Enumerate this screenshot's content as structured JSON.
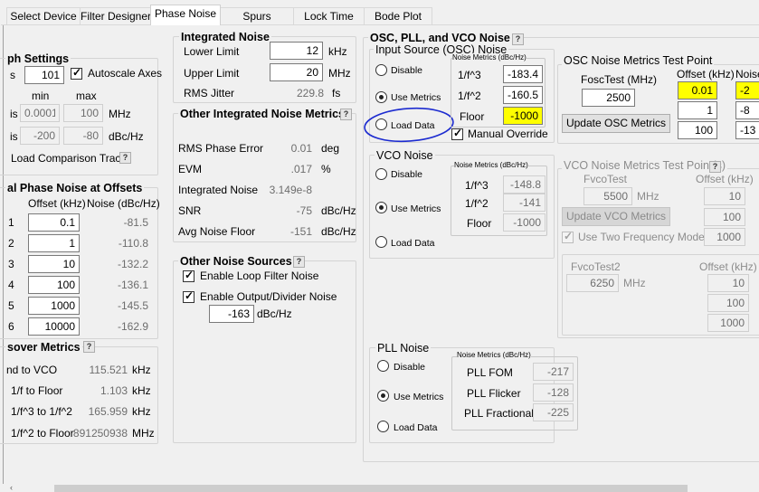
{
  "tabs": [
    "Select Device",
    "Filter Designer",
    "Phase Noise",
    "Spurs",
    "Lock Time",
    "Bode Plot"
  ],
  "graph": {
    "title": "ph Settings",
    "s_label": "s",
    "s_value": "101",
    "autoscale": "Autoscale Axes",
    "min": "min",
    "max": "max",
    "is1": "is",
    "xmin": "0.0001",
    "xmax": "100",
    "xunit": "MHz",
    "is2": "is",
    "ymin": "-200",
    "ymax": "-80",
    "yunit": "dBc/Hz",
    "load_trace": "Load Comparison Trace"
  },
  "offsets": {
    "title": "al Phase Noise at Offsets",
    "col_offset": "Offset (kHz)",
    "col_noise": "Noise (dBc/Hz)",
    "rows": [
      {
        "n": "1",
        "offset": "0.1",
        "noise": "-81.5"
      },
      {
        "n": "2",
        "offset": "1",
        "noise": "-110.8"
      },
      {
        "n": "3",
        "offset": "10",
        "noise": "-132.2"
      },
      {
        "n": "4",
        "offset": "100",
        "noise": "-136.1"
      },
      {
        "n": "5",
        "offset": "1000",
        "noise": "-145.5"
      },
      {
        "n": "6",
        "offset": "10000",
        "noise": "-162.9"
      }
    ]
  },
  "crossover": {
    "title": "sover Metrics",
    "rows": [
      {
        "label": "nd to VCO",
        "value": "115.521",
        "unit": "kHz"
      },
      {
        "label": "1/f to Floor",
        "value": "1.103",
        "unit": "kHz"
      },
      {
        "label": "1/f^3 to 1/f^2",
        "value": "165.959",
        "unit": "kHz"
      },
      {
        "label": "1/f^2 to Floor",
        "value": "891250938",
        "unit": "MHz"
      }
    ]
  },
  "integrated": {
    "title": "Integrated Noise",
    "lower_label": "Lower Limit",
    "lower": "12",
    "lower_unit": "kHz",
    "upper_label": "Upper Limit",
    "upper": "20",
    "upper_unit": "MHz",
    "rms_label": "RMS Jitter",
    "rms": "229.8",
    "rms_unit": "fs"
  },
  "metrics": {
    "title": "Other Integrated Noise Metrics",
    "rows": [
      {
        "label": "RMS Phase Error",
        "value": "0.01",
        "unit": "deg"
      },
      {
        "label": "EVM",
        "value": ".017",
        "unit": "%"
      },
      {
        "label": "Integrated Noise",
        "value": "3.149e-8",
        "unit": ""
      },
      {
        "label": "SNR",
        "value": "-75",
        "unit": "dBc/Hz"
      },
      {
        "label": "Avg Noise Floor",
        "value": "-151",
        "unit": "dBc/Hz"
      }
    ]
  },
  "other_sources": {
    "title": "Other Noise Sources",
    "loop": "Enable Loop Filter Noise",
    "output": "Enable Output/Divider Noise",
    "value": "-163",
    "unit": "dBc/Hz"
  },
  "osc": {
    "title": "OSC, PLL, and VCO Noise",
    "input_title": "Input Source (OSC) Noise",
    "disable": "Disable",
    "use_metrics": "Use Metrics",
    "load_data": "Load Data",
    "nm_title": "Noise Metrics (dBc/Hz)",
    "f3_label": "1/f^3",
    "f3": "-183.4",
    "f2_label": "1/f^2",
    "f2": "-160.5",
    "floor_label": "Floor",
    "floor": "-1000",
    "manual": "Manual Override"
  },
  "osc_test": {
    "title": "OSC Noise Metrics Test Point",
    "fosc_label": "FoscTest (MHz)",
    "fosc": "2500",
    "update": "Update OSC Metrics",
    "off_hdr": "Offset (kHz)",
    "noise_hdr": "Noise",
    "offsets": [
      "0.01",
      "1",
      "100"
    ],
    "noises": [
      "-2",
      "-8",
      "-13"
    ]
  },
  "vco": {
    "title": "VCO Noise",
    "disable": "Disable",
    "use_metrics": "Use Metrics",
    "load_data": "Load Data",
    "nm_title": "Noise Metrics (dBc/Hz)",
    "f3_label": "1/f^3",
    "f3": "-148.8",
    "f2_label": "1/f^2",
    "f2": "-141",
    "floor_label": "Floor",
    "floor": "-1000"
  },
  "vco_test": {
    "title": "VCO Noise Metrics Test Point(s)",
    "fvco_label": "FvcoTest",
    "fvco": "5500",
    "unit": "MHz",
    "update": "Update VCO Metrics",
    "two_freq": "Use Two Frequency Model",
    "off_hdr": "Offset (kHz)",
    "offsets": [
      "10",
      "100",
      "1000"
    ],
    "fvco2_label": "FvcoTest2",
    "fvco2": "6250",
    "unit2": "MHz",
    "off_hdr2": "Offset (kHz)",
    "offsets2": [
      "10",
      "100",
      "1000"
    ]
  },
  "pll": {
    "title": "PLL Noise",
    "disable": "Disable",
    "use_metrics": "Use Metrics",
    "load_data": "Load Data",
    "nm_title": "Noise Metrics (dBc/Hz)",
    "fom_label": "PLL FOM",
    "fom": "-217",
    "flicker_label": "PLL Flicker",
    "flicker": "-128",
    "frac_label": "PLL Fractional",
    "frac": "-225"
  },
  "help": "?"
}
